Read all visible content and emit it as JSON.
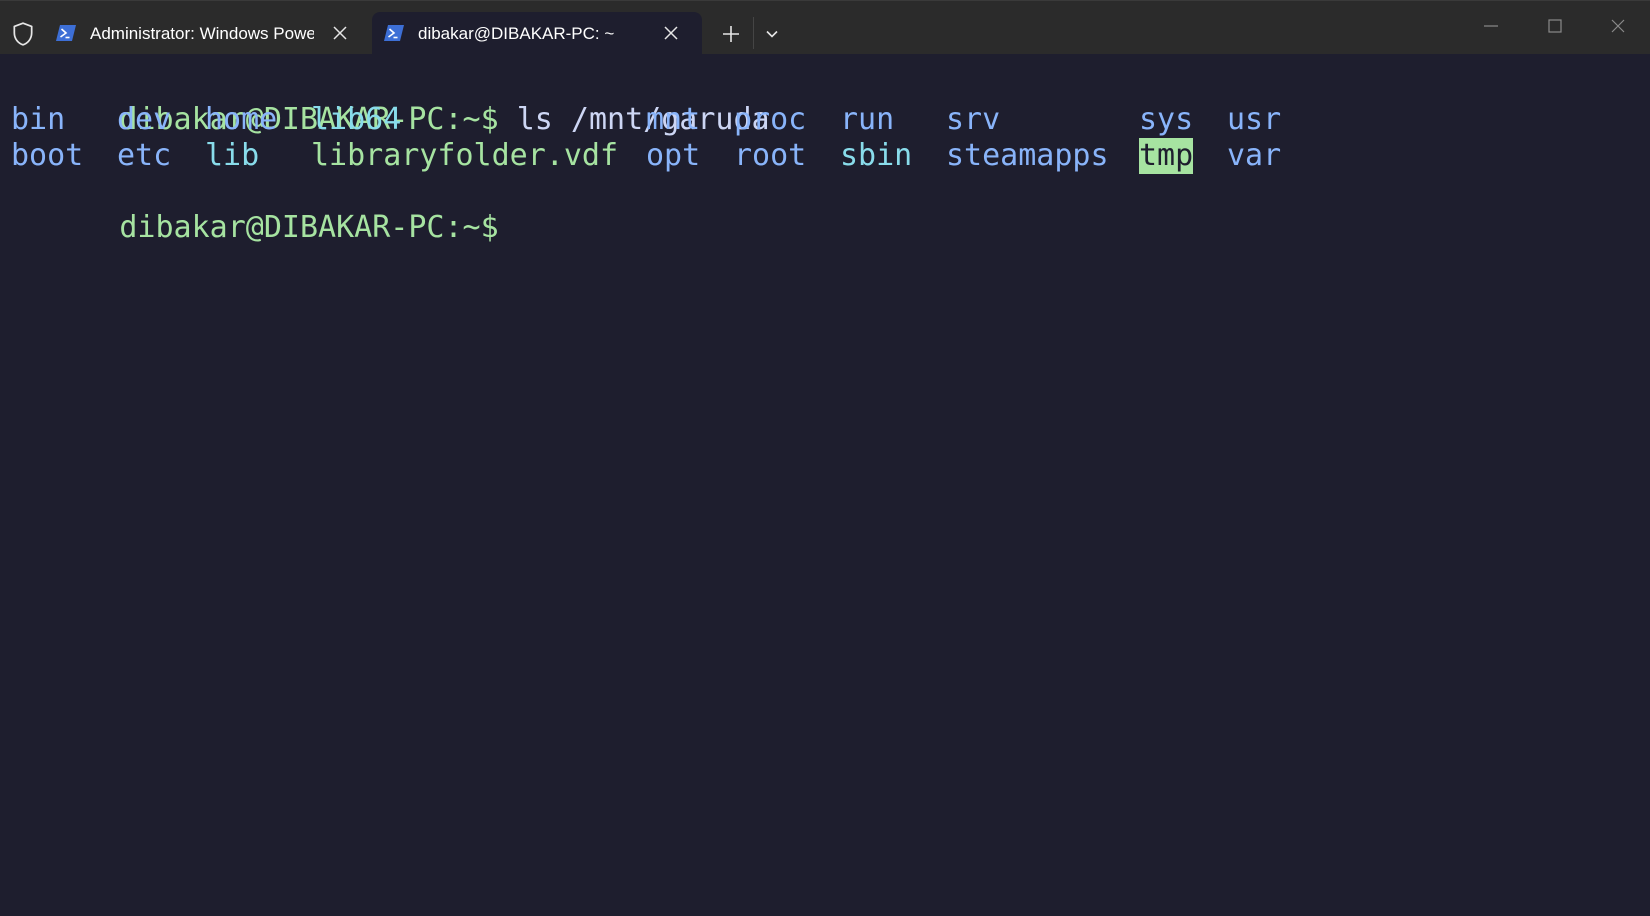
{
  "titlebar": {
    "tabs": [
      {
        "title": "Administrator: Windows PowerShell",
        "active": false,
        "icon": "powershell-icon"
      },
      {
        "title": "dibakar@DIBAKAR-PC: ~",
        "active": true,
        "icon": "powershell-icon"
      }
    ],
    "buttons": {
      "new_tab_icon": "plus-icon",
      "dropdown_icon": "chevron-down-icon",
      "minimize_icon": "minimize-icon",
      "maximize_icon": "maximize-icon",
      "close_icon": "close-icon"
    }
  },
  "terminal": {
    "prompt": "dibakar@DIBAKAR-PC:~$",
    "command": "ls /mnt/garuda",
    "listing": {
      "row1": [
        {
          "name": "bin",
          "kind": "dir"
        },
        {
          "name": "dev",
          "kind": "dir"
        },
        {
          "name": "home",
          "kind": "dir"
        },
        {
          "name": "lib64",
          "kind": "link"
        },
        {
          "name": "mnt",
          "kind": "dir"
        },
        {
          "name": "proc",
          "kind": "dir"
        },
        {
          "name": "run",
          "kind": "dir"
        },
        {
          "name": "srv",
          "kind": "dir"
        },
        {
          "name": "sys",
          "kind": "dir"
        },
        {
          "name": "usr",
          "kind": "dir"
        }
      ],
      "row2": [
        {
          "name": "boot",
          "kind": "dir"
        },
        {
          "name": "etc",
          "kind": "dir"
        },
        {
          "name": "lib",
          "kind": "link"
        },
        {
          "name": "libraryfolder.vdf",
          "kind": "file"
        },
        {
          "name": "opt",
          "kind": "dir"
        },
        {
          "name": "root",
          "kind": "dir"
        },
        {
          "name": "sbin",
          "kind": "link"
        },
        {
          "name": "steamapps",
          "kind": "dir"
        },
        {
          "name": "tmp",
          "kind": "sticky"
        },
        {
          "name": "var",
          "kind": "dir"
        }
      ]
    }
  },
  "colors": {
    "background": "#1e1e2e",
    "titlebar": "#2b2b2b",
    "prompt": "#a6e3a1",
    "directory": "#89b4fa",
    "symlink": "#89dceb",
    "file": "#a6e3a1",
    "sticky_highlight": "#a6e3a1"
  }
}
